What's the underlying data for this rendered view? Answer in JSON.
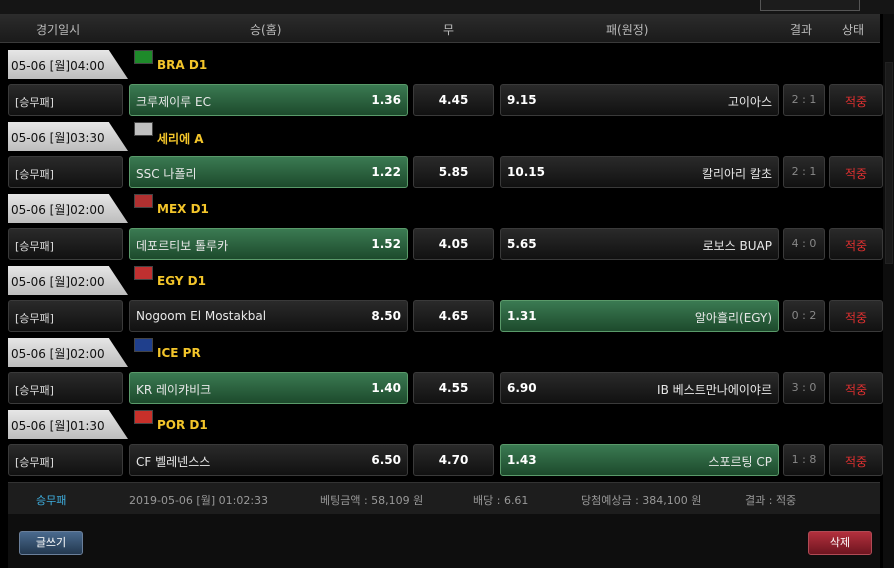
{
  "header": {
    "col_time": "경기일시",
    "col_home": "승(홈)",
    "col_draw": "무",
    "col_away": "패(원정)",
    "col_result": "결과",
    "col_status": "상태"
  },
  "flag_colors": [
    "#1e8a2a",
    "#c0c0c0",
    "#b03030",
    "#c03030",
    "#1f3f8c",
    "#c8302a"
  ],
  "games": [
    {
      "date": "05-06 [월]04:00",
      "league": "BRA D1",
      "bet_type": "[승무패]",
      "home": "크루제이루 EC",
      "home_odds": "1.36",
      "draw_odds": "4.45",
      "away": "고이아스",
      "away_odds": "9.15",
      "score": "2 : 1",
      "status": "적중",
      "selected": "home"
    },
    {
      "date": "05-06 [월]03:30",
      "league": "세리에 A",
      "bet_type": "[승무패]",
      "home": "SSC 나폴리",
      "home_odds": "1.22",
      "draw_odds": "5.85",
      "away": "칼리아리 칼초",
      "away_odds": "10.15",
      "score": "2 : 1",
      "status": "적중",
      "selected": "home"
    },
    {
      "date": "05-06 [월]02:00",
      "league": "MEX D1",
      "bet_type": "[승무패]",
      "home": "데포르티보 톨루카",
      "home_odds": "1.52",
      "draw_odds": "4.05",
      "away": "로보스 BUAP",
      "away_odds": "5.65",
      "score": "4 : 0",
      "status": "적중",
      "selected": "home"
    },
    {
      "date": "05-06 [월]02:00",
      "league": "EGY D1",
      "bet_type": "[승무패]",
      "home": "Nogoom El Mostakbal",
      "home_odds": "8.50",
      "draw_odds": "4.65",
      "away": "알아흘리(EGY)",
      "away_odds": "1.31",
      "score": "0 : 2",
      "status": "적중",
      "selected": "away"
    },
    {
      "date": "05-06 [월]02:00",
      "league": "ICE PR",
      "bet_type": "[승무패]",
      "home": "KR 레이캬비크",
      "home_odds": "1.40",
      "draw_odds": "4.55",
      "away": "IB 베스트만나에이야르",
      "away_odds": "6.90",
      "score": "3 : 0",
      "status": "적중",
      "selected": "home"
    },
    {
      "date": "05-06 [월]01:30",
      "league": "POR D1",
      "bet_type": "[승무패]",
      "home": "CF 벨레넨스스",
      "home_odds": "6.50",
      "draw_odds": "4.70",
      "away": "스포르팅 CP",
      "away_odds": "1.43",
      "score": "1 : 8",
      "status": "적중",
      "selected": "away"
    }
  ],
  "summary": {
    "type": "승무패",
    "datetime": "2019-05-06 [월] 01:02:33",
    "bet_amount": "베팅금액 : 58,109 원",
    "odds": "배당 : 6.61",
    "expected": "당첨예상금 : 384,100 원",
    "result": "결과 : 적중"
  },
  "buttons": {
    "write": "글쓰기",
    "delete": "삭제"
  }
}
